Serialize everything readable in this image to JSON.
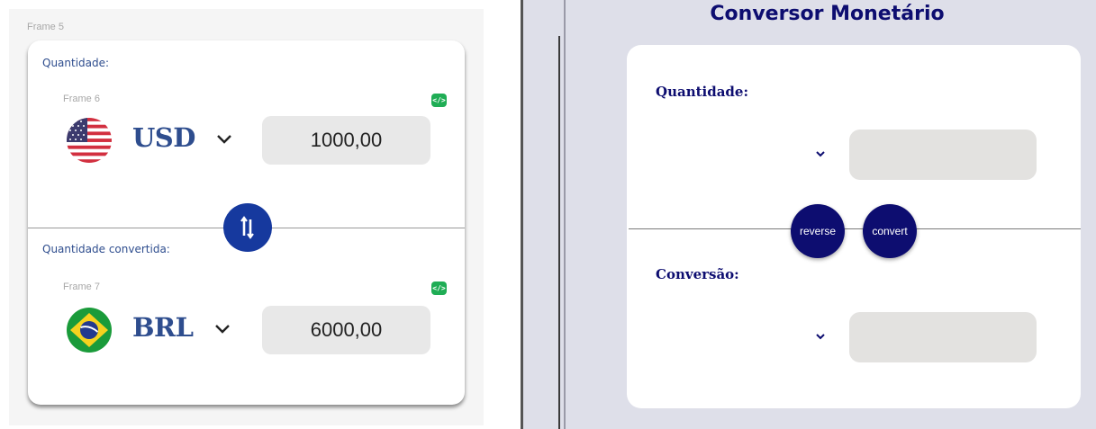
{
  "mockup": {
    "frame_outer_label": "Frame 5",
    "amount_label": "Quantidade:",
    "converted_label": "Quantidade convertida:",
    "from": {
      "frame_label": "Frame 6",
      "flag_icon": "us-flag-icon",
      "currency_code": "USD",
      "value": "1000,00",
      "code_badge": "</>"
    },
    "to": {
      "frame_label": "Frame 7",
      "flag_icon": "brazil-flag-icon",
      "currency_code": "BRL",
      "value": "6000,00",
      "code_badge": "</>"
    },
    "swap_icon": "swap-vertical-icon",
    "colors": {
      "accent": "#16399e",
      "text": "#2e4d8e",
      "badge": "#1fad55"
    }
  },
  "app": {
    "title": "Conversor Monetário",
    "amount_label": "Quantidade:",
    "conversion_label": "Conversão:",
    "amount_input_value": "",
    "conversion_input_value": "",
    "reverse_button": "reverse",
    "convert_button": "convert",
    "select_icon": "chevron-down-icon",
    "colors": {
      "primary": "#0d0d70",
      "background": "#dedfe9",
      "input": "#e3e2e0"
    }
  }
}
